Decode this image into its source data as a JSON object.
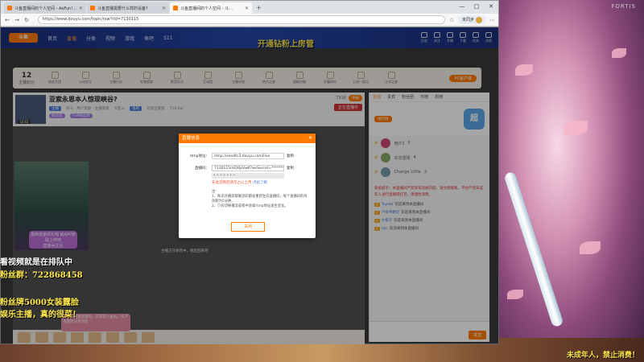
{
  "browser": {
    "tabs": [
      {
        "label": "斗鱼直播间的个人空间 - AeFun!…",
        "active": false
      },
      {
        "label": "斗鱼直播需要什么样的设备?",
        "active": false
      },
      {
        "label": "斗鱼直播间的个人空间 - 斗…",
        "active": true
      }
    ],
    "new_tab": "+",
    "url": "https://www.douyu.com/topic/rsw?rid=7130115",
    "profile_label": "未同步",
    "window_controls": [
      "—",
      "□",
      "✕"
    ]
  },
  "site": {
    "logo": "斗鱼",
    "nav": [
      "首页",
      "直播",
      "分类",
      "视频",
      "游戏",
      "鱼吧",
      "S11"
    ],
    "nav_active": "直播",
    "right_icons": [
      "历史",
      "关注",
      "开播",
      "下载",
      "任务",
      "消息"
    ]
  },
  "promo_text": "开通钻粉上房管",
  "giftbar": {
    "rank_number": "12",
    "rank_label": "主播积分",
    "items": [
      "粉丝大团",
      "心动信号",
      "主播日志",
      "礼物奖励",
      "影音乐点",
      "互动团",
      "主播计划",
      "热力之星",
      "超级应援",
      "学霸研究",
      "上班一起玩",
      "让学之星"
    ],
    "pc_client": "PC客户端"
  },
  "room": {
    "title": "亚索永恩本人惊现峡谷?",
    "meta_1": "阿斗 · 用户等级 · 主播等级",
    "badge_1": "主播",
    "meta_2": "大乱斗",
    "badge_2": "鱼吧",
    "meta_3": "双排全联盟",
    "fans": "714.6w",
    "follow_count": "7318",
    "report": "举报",
    "badge_followers": "粉丝团",
    "badge_group": "TOP粉丝牌",
    "live_btn": "正在直播中",
    "level": "LV.42"
  },
  "catcard_banner": "露西弟弟领礼物 就APP获取上传吧",
  "catcard_banner_2": "直播间主页",
  "overlays": {
    "line1": "看视频就是在排队中",
    "line2": "粉丝群：722868458",
    "line3": "粉丝牌5000女装露脸",
    "line4": "娱乐主播，真的很菜！"
  },
  "chat": {
    "tabs": [
      "互动",
      "贵宾",
      "粉丝团",
      "日榜",
      "周榜"
    ],
    "active_tab": "互动",
    "top_btn": "排行榜",
    "mascot": "超",
    "rank_rows": [
      {
        "name": "用户1",
        "value": "5"
      },
      {
        "name": "灰灰雪球",
        "value": "4"
      },
      {
        "name": "Change Little",
        "value": "3"
      }
    ],
    "notice": "系统提示：本直播间严禁发布违规内容，请文明观看。平台严禁未成年人进行直播或打赏，请理性消费。",
    "messages": [
      {
        "tag": "V",
        "user": "Toyota",
        "text": "欢迎来到本直播间"
      },
      {
        "tag": "V",
        "user": "卢本伟精灵",
        "text": "欢迎来到本直播间"
      },
      {
        "tag": "V",
        "user": "大橙子",
        "text": "欢迎来到本直播间"
      },
      {
        "tag": "V",
        "user": "abc",
        "text": "欢迎来到本直播间"
      }
    ],
    "send": "发送"
  },
  "modal": {
    "title": "直播信息",
    "close": "✕",
    "rtmp_label": "rtmp地址：",
    "rtmp_value": "rtmp://sendtc3.douyu.com/live",
    "copy": "复制",
    "code_label": "直播码：",
    "code_value": "7130115rHDOpVwlf?wsSecret=*******",
    "code_mask": "• • • • • • •",
    "warn": "非此流断后请勿占以上传",
    "warn_link": "点此了解",
    "notes_title": "注:",
    "note_1": "1、每次开播获取确流码都会重新生成直播码，每个直播码的有效期为5分钟。",
    "note_2": "2、只有切换播流或者中途拿rtmp地址发生变化。",
    "ok": "关闭"
  },
  "below_modal": "主播正在休息中，稍后回来吧",
  "pink_tip": "小鱼丸赠送流量包，可获得小鱼丸、仅产生游戏分享内容",
  "watermark": "FORTIS",
  "bottom_right": "未成年人，禁止消费！",
  "colors": {
    "accent": "#ff7a00",
    "nav": "#1e3a8a",
    "overlay_text": "#ffe94a"
  }
}
